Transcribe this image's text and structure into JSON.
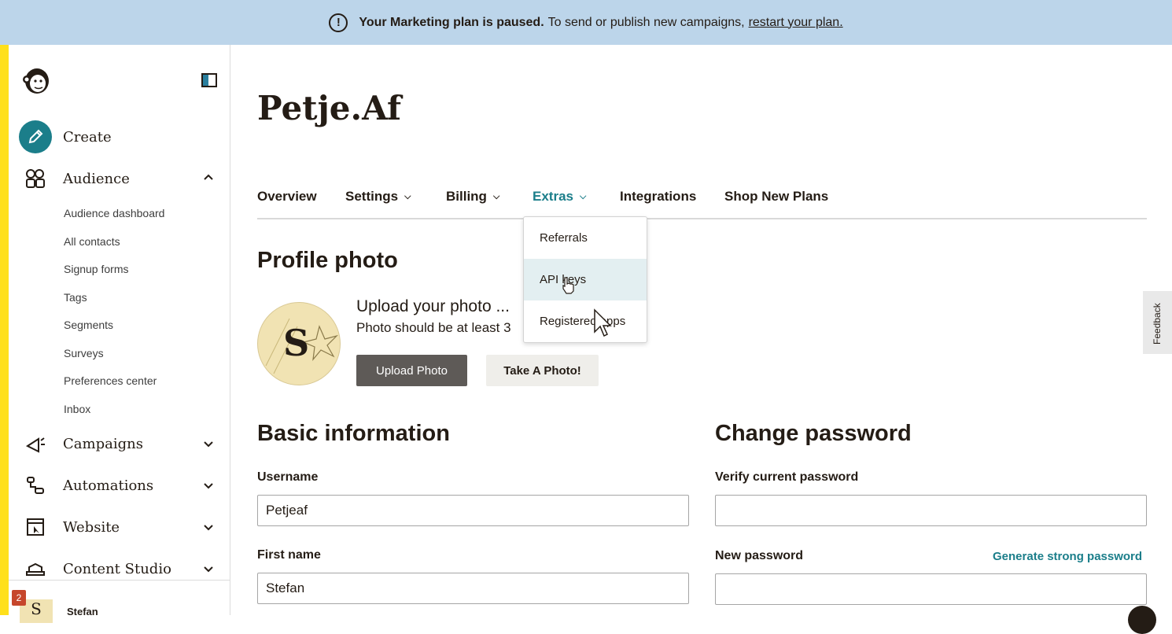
{
  "banner": {
    "bold": "Your Marketing plan is paused.",
    "text": "To send or publish new campaigns,",
    "link": "restart your plan."
  },
  "sidebar": {
    "create": "Create",
    "audience": "Audience",
    "audience_items": [
      "Audience dashboard",
      "All contacts",
      "Signup forms",
      "Tags",
      "Segments",
      "Surveys",
      "Preferences center",
      "Inbox"
    ],
    "campaigns": "Campaigns",
    "automations": "Automations",
    "website": "Website",
    "content_studio": "Content Studio",
    "notification_count": "2",
    "user_initial": "S",
    "user_name": "Stefan"
  },
  "page": {
    "title": "Petje.Af"
  },
  "tabs": [
    "Overview",
    "Settings",
    "Billing",
    "Extras",
    "Integrations",
    "Shop New Plans"
  ],
  "extras_menu": [
    "Referrals",
    "API keys",
    "Registered apps"
  ],
  "profile": {
    "heading": "Profile photo",
    "initial": "S",
    "upload_title": "Upload your photo ...",
    "upload_sub": "Photo should be at least 3",
    "upload_btn": "Upload Photo",
    "take_btn": "Take A Photo!"
  },
  "basic": {
    "heading": "Basic information",
    "username_label": "Username",
    "username_value": "Petjeaf",
    "firstname_label": "First name",
    "firstname_value": "Stefan"
  },
  "password": {
    "heading": "Change password",
    "verify_label": "Verify current password",
    "new_label": "New password",
    "generate": "Generate strong password"
  },
  "feedback": "Feedback",
  "colors": {
    "accent": "#1b7e8a",
    "banner": "#bcd5ea",
    "brand_yellow": "#ffe01b"
  }
}
